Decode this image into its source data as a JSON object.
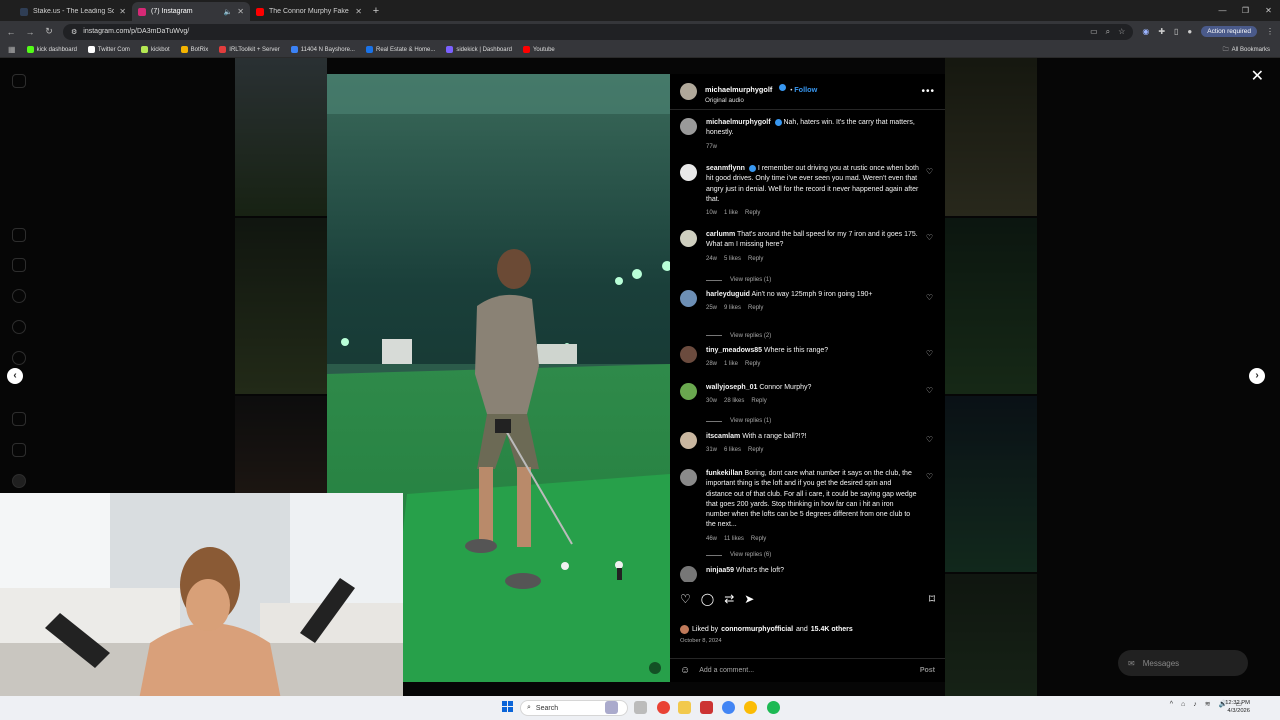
{
  "browser": {
    "tabs": [
      {
        "label": "Stake.us - The Leading Social C",
        "active": false,
        "favicon_color": "#2f3e55"
      },
      {
        "label": "(7) Instagram",
        "active": true,
        "favicon_color": "#d62976"
      },
      {
        "label": "The Connor Murphy Fake Shirt",
        "active": false,
        "favicon_color": "#ff0000"
      }
    ],
    "url": "instagram.com/p/DA3mDaTuWvg/",
    "action_required": "Action required",
    "bookmarks": [
      {
        "label": "kick dashboard",
        "color": "#53fc18"
      },
      {
        "label": "Twitter Com",
        "color": "#ffffff"
      },
      {
        "label": "kickbot",
        "color": "#b5e853"
      },
      {
        "label": "BotRix",
        "color": "#f5b400"
      },
      {
        "label": "IRLToolkit + Server",
        "color": "#e23d3d"
      },
      {
        "label": "11404 N Bayshore...",
        "color": "#3b82f6"
      },
      {
        "label": "Real Estate & Home...",
        "color": "#1a73e8"
      },
      {
        "label": "sidekick | Dashboard",
        "color": "#7b61ff"
      },
      {
        "label": "Youtube",
        "color": "#ff0000"
      }
    ],
    "all_bookmarks": "All Bookmarks"
  },
  "post": {
    "author": "michaelmurphygolf",
    "follow": "Follow",
    "audio": "Original audio",
    "more": "•••",
    "comments": [
      {
        "user": "michaelmurphygolf",
        "text": "Nah, haters win. It's the carry that matters, honestly.",
        "age": "77w",
        "likes": "",
        "reply": "",
        "verified": true,
        "avatar": "#9a9a9a"
      },
      {
        "user": "seanmflynn",
        "text": "I remember out driving you at rustic once when both hit good drives. Only time i've ever seen you mad. Weren't even that angry just in denial. Well for the record it never happened again after that.",
        "age": "10w",
        "likes": "1 like",
        "reply": "Reply",
        "verified": true,
        "avatar": "#e8e8e8"
      },
      {
        "user": "carlumm",
        "text": "That's around the ball speed for my 7 iron and it goes 175. What am I missing here?",
        "age": "24w",
        "likes": "5 likes",
        "reply": "Reply",
        "replies": "View replies (1)",
        "avatar": "#cfcfbf"
      },
      {
        "user": "harleyduguid",
        "text": "Ain't no way 125mph 9 iron going 190+",
        "age": "25w",
        "likes": "9 likes",
        "reply": "Reply",
        "replies": "View replies (2)",
        "avatar": "#6d8fb5"
      },
      {
        "user": "tiny_meadows85",
        "text": "Where is this range?",
        "age": "28w",
        "likes": "1 like",
        "reply": "Reply",
        "avatar": "#6b4b3e"
      },
      {
        "user": "wallyjoseph_01",
        "text": "Connor Murphy?",
        "age": "30w",
        "likes": "28 likes",
        "reply": "Reply",
        "replies": "View replies (1)",
        "avatar": "#6aa84f"
      },
      {
        "user": "itscamlam",
        "text": "With a range ball?!?!",
        "age": "31w",
        "likes": "6 likes",
        "reply": "Reply",
        "avatar": "#c9b7a0"
      },
      {
        "user": "funkekillan",
        "text": "Boring, dont care what number it says on the club, the important thing is the loft and if you get the desired spin and distance out of that club. For all i care, it could be saying gap wedge that goes 200 yards. Stop thinking in how far can i hit an iron number when the lofts can be 5 degrees different from one club to the next...",
        "age": "46w",
        "likes": "11 likes",
        "reply": "Reply",
        "replies": "View replies (6)",
        "avatar": "#8a8a8a"
      },
      {
        "user": "ninjaa59",
        "text": "What's the loft?",
        "age": "",
        "likes": "",
        "reply": "",
        "avatar": "#777777"
      }
    ],
    "liked_by_prefix": "Liked by",
    "liked_by_user": "connormurphyofficial",
    "liked_by_and": "and",
    "liked_by_others": "15.4K others",
    "date": "October 8, 2024",
    "add_comment_placeholder": "Add a comment...",
    "post_label": "Post"
  },
  "messages_label": "Messages",
  "taskbar": {
    "search": "Search",
    "time": "12:32 PM",
    "date": "4/3/2026"
  }
}
